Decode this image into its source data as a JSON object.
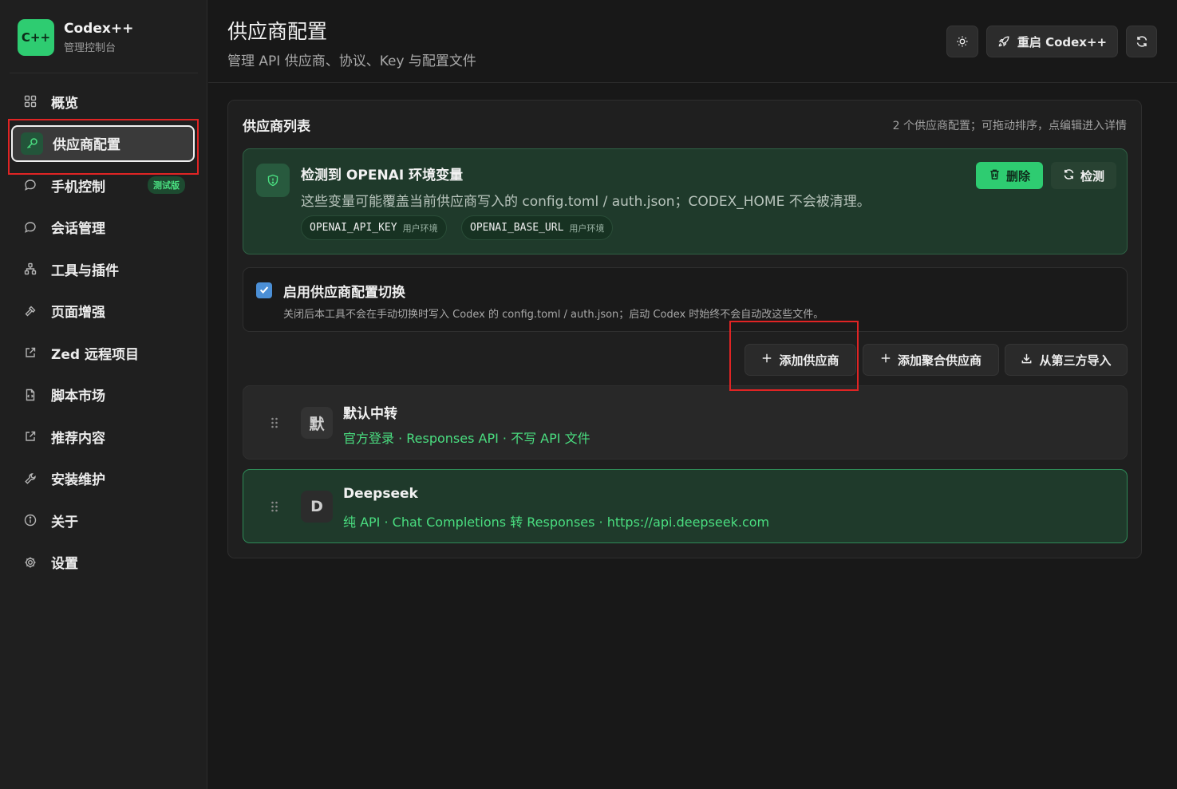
{
  "brand": {
    "logo": "C++",
    "name": "Codex++",
    "subtitle": "管理控制台"
  },
  "nav": [
    {
      "label": "概览",
      "icon": "grid-icon"
    },
    {
      "label": "供应商配置",
      "icon": "key-icon",
      "active": true
    },
    {
      "label": "手机控制",
      "icon": "chat-icon",
      "badge": "测试版"
    },
    {
      "label": "会话管理",
      "icon": "chat-icon"
    },
    {
      "label": "工具与插件",
      "icon": "network-icon"
    },
    {
      "label": "页面增强",
      "icon": "hammer-icon"
    },
    {
      "label": "Zed 远程项目",
      "icon": "external-link-icon"
    },
    {
      "label": "脚本市场",
      "icon": "script-file-icon"
    },
    {
      "label": "推荐内容",
      "icon": "external-link-icon"
    },
    {
      "label": "安装维护",
      "icon": "wrench-icon"
    },
    {
      "label": "关于",
      "icon": "info-icon"
    },
    {
      "label": "设置",
      "icon": "gear-icon"
    }
  ],
  "header": {
    "title": "供应商配置",
    "subtitle": "管理 API 供应商、协议、Key 与配置文件",
    "restart_label": "重启 Codex++"
  },
  "panel": {
    "title": "供应商列表",
    "count_text": "2 个供应商配置；可拖动排序，点编辑进入详情"
  },
  "env_notice": {
    "title": "检测到 OPENAI 环境变量",
    "description": "这些变量可能覆盖当前供应商写入的 config.toml / auth.json；CODEX_HOME 不会被清理。",
    "delete_label": "删除",
    "check_label": "检测",
    "vars": [
      {
        "key": "OPENAI_API_KEY",
        "scope": "用户环境"
      },
      {
        "key": "OPENAI_BASE_URL",
        "scope": "用户环境"
      }
    ]
  },
  "switch_toggle": {
    "checked": true,
    "title": "启用供应商配置切换",
    "description": "关闭后本工具不会在手动切换时写入 Codex 的 config.toml / auth.json；启动 Codex 时始终不会自动改这些文件。"
  },
  "actions": {
    "add_provider": "添加供应商",
    "add_aggregate": "添加聚合供应商",
    "import_third_party": "从第三方导入"
  },
  "providers": [
    {
      "avatar": "默",
      "name": "默认中转",
      "meta": "官方登录 · Responses API · 不写 API 文件"
    },
    {
      "avatar": "D",
      "name": "Deepseek",
      "meta": "纯 API · Chat Completions 转 Responses · https://api.deepseek.com"
    }
  ],
  "colors": {
    "accent": "#2ecc71",
    "accent_text": "#4ade80",
    "highlight": "#e02424"
  }
}
